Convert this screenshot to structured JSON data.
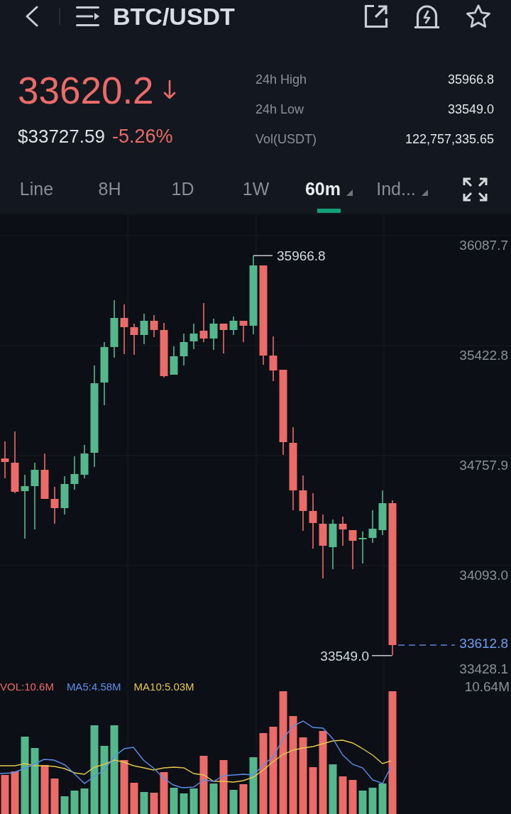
{
  "header": {
    "title": "BTC/USDT"
  },
  "ticker": {
    "last_price": "33620.2",
    "falling": true,
    "fiat_price": "$33727.59",
    "change": "-5.26%"
  },
  "stats": [
    {
      "label": "24h High",
      "value": "35966.8"
    },
    {
      "label": "24h Low",
      "value": "33549.0"
    },
    {
      "label": "Vol(USDT)",
      "value": "122,757,335.65"
    }
  ],
  "interval_tabs": [
    {
      "label": "Line",
      "kind": "plain",
      "selected": false
    },
    {
      "label": "8H",
      "kind": "plain",
      "selected": false
    },
    {
      "label": "1D",
      "kind": "plain",
      "selected": false
    },
    {
      "label": "1W",
      "kind": "plain",
      "selected": false
    },
    {
      "label": "60m",
      "kind": "dropdown",
      "selected": true
    },
    {
      "label": "Ind...",
      "kind": "dropdown",
      "selected": false
    }
  ],
  "price_chart": {
    "chart_data": {
      "type": "candlestick",
      "grid": true,
      "ylim": [
        33428.1,
        36216.4
      ],
      "yticks": [
        {
          "value": 36087.7,
          "label": "36087.7"
        },
        {
          "value": 35422.8,
          "label": "35422.8"
        },
        {
          "value": 34757.9,
          "label": "34757.9"
        },
        {
          "value": 34093,
          "label": "34093.0"
        }
      ],
      "ohlc": [
        [
          34740.7,
          34843.7,
          34620.6,
          34719.3
        ],
        [
          34715.0,
          34903.7,
          34530.5,
          34539.1
        ],
        [
          34543.4,
          34642.1,
          34256.0,
          34573.4
        ],
        [
          34573.4,
          34715.0,
          34311.8,
          34672.1
        ],
        [
          34672.1,
          34770.8,
          34496.2,
          34496.2
        ],
        [
          34496.2,
          34569.2,
          34346.1,
          34440.5
        ],
        [
          34440.5,
          34633.5,
          34401.9,
          34586.3
        ],
        [
          34586.3,
          34753.6,
          34552.0,
          34646.4
        ],
        [
          34642.1,
          34822.2,
          34620.6,
          34770.8
        ],
        [
          34775.1,
          35302.7,
          34689.3,
          35195.4
        ],
        [
          35199.7,
          35444.2,
          35062.5,
          35414.2
        ],
        [
          35414.2,
          35697.3,
          35349.9,
          35590.1
        ],
        [
          35590.1,
          35671.6,
          35371.3,
          35534.3
        ],
        [
          35534.3,
          35555.8,
          35367.0,
          35487.1
        ],
        [
          35487.1,
          35615.8,
          35431.4,
          35572.9
        ],
        [
          35572.9,
          35607.3,
          35474.3,
          35517.2
        ],
        [
          35517.2,
          35560.1,
          35229.8,
          35238.3
        ],
        [
          35246.9,
          35418.5,
          35246.9,
          35358.5
        ],
        [
          35358.5,
          35495.7,
          35302.7,
          35444.2
        ],
        [
          35448.5,
          35555.8,
          35401.4,
          35495.7
        ],
        [
          35512.9,
          35680.2,
          35444.2,
          35465.7
        ],
        [
          35465.7,
          35585.8,
          35397.1,
          35555.8
        ],
        [
          35555.8,
          35555.8,
          35375.6,
          35517.2
        ],
        [
          35517.2,
          35598.7,
          35487.1,
          35572.9
        ],
        [
          35572.9,
          35572.9,
          35444.2,
          35542.9
        ],
        [
          35542.9,
          35966.8,
          35491.4,
          35907.5
        ],
        [
          35907.5,
          35907.5,
          35307.0,
          35362.7
        ],
        [
          35362.7,
          35478.6,
          35208.3,
          35272.7
        ],
        [
          35277.0,
          35277.0,
          34762.2,
          34839.4
        ],
        [
          34835.1,
          34929.5,
          34427.6,
          34547.7
        ],
        [
          34547.7,
          34637.8,
          34303.2,
          34423.3
        ],
        [
          34423.3,
          34530.5,
          34195.9,
          34350.4
        ],
        [
          34346.1,
          34401.9,
          34015.8,
          34213.1
        ],
        [
          34204.5,
          34371.8,
          34071.5,
          34346.1
        ],
        [
          34346.1,
          34389.0,
          34213.1,
          34311.8
        ],
        [
          34307.5,
          34307.5,
          34071.5,
          34243.1
        ],
        [
          34251.7,
          34298.9,
          34105.9,
          34260.3
        ],
        [
          34260.3,
          34427.6,
          34230.3,
          34316.1
        ],
        [
          34307.5,
          34547.7,
          34277.5,
          34470.5
        ],
        [
          34470.5,
          34487.6,
          33549.0,
          33612.8
        ]
      ]
    },
    "high_label": "35966.8",
    "low_label": "33549.0",
    "last_price_label": "33612.8",
    "bottom_axis_label": "33428.1"
  },
  "volume_chart": {
    "legend": [
      {
        "label": "VOL:10.6M",
        "color": "#ea6b68"
      },
      {
        "label": "MA5:4.58M",
        "color": "#5d8fea"
      },
      {
        "label": "MA10:5.03M",
        "color": "#e5c74c"
      }
    ],
    "axis_label": "10.64M"
  }
}
